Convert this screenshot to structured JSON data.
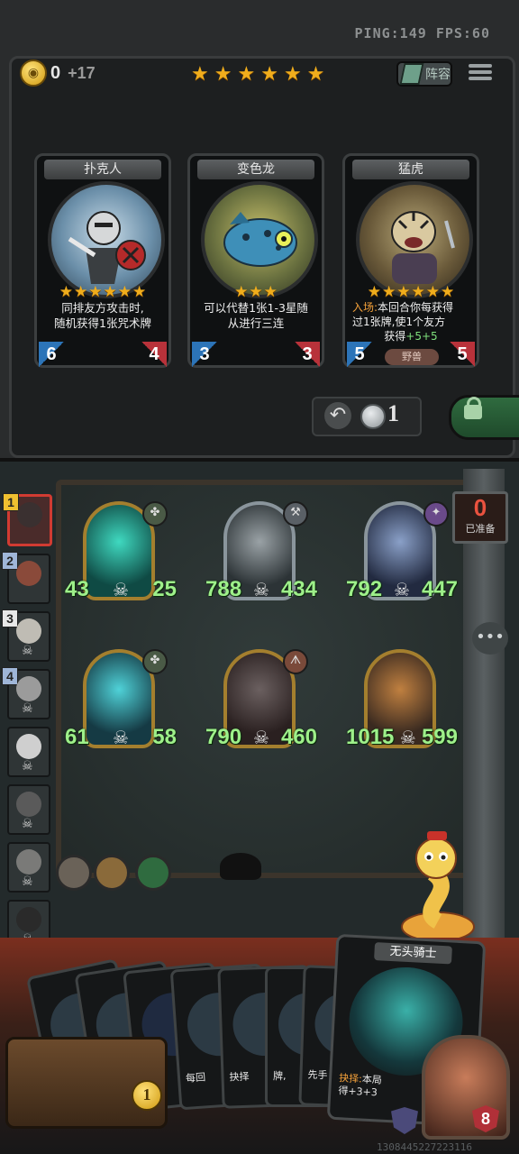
{
  "hud": {
    "ping": "PING:149",
    "fps": "FPS:60",
    "coins": "0",
    "coin_income": "+17",
    "tavern_stars": 6,
    "lineup_label": "阵容"
  },
  "shop": {
    "cards": [
      {
        "name": "扑克人",
        "stars": 6,
        "desc_1": "同排友方攻击时,",
        "desc_2": "随机获得1张咒术牌",
        "attack": "6",
        "health": "4"
      },
      {
        "name": "变色龙",
        "stars": 3,
        "desc_1": "可以代替1张1-3星随",
        "desc_2": "从进行三连",
        "attack": "3",
        "health": "3"
      },
      {
        "name": "猛虎",
        "stars": 6,
        "desc_hl": "入场:",
        "desc_1": "本回合你每获得",
        "desc_2": "过1张牌,使1个友方",
        "desc_3a": "获得",
        "desc_3b": "+5",
        "desc_3c": "+5",
        "tribe": "野兽",
        "attack": "5",
        "health": "5"
      }
    ],
    "refresh_cost": "1"
  },
  "board": {
    "ready_count": "0",
    "ready_label": "已准备",
    "minions": [
      {
        "attack": "43",
        "health": "25",
        "frame": "gold",
        "tribe_icon": "paw-icon"
      },
      {
        "attack": "788",
        "health": "434",
        "frame": "silver",
        "tribe_icon": "wrench-icon"
      },
      {
        "attack": "792",
        "health": "447",
        "frame": "silver",
        "tribe_icon": "magic-icon"
      },
      {
        "attack": "61",
        "health": "58",
        "frame": "gold",
        "tribe_icon": "paw-icon"
      },
      {
        "attack": "790",
        "health": "460",
        "frame": "gold",
        "tribe_icon": "claw-icon"
      },
      {
        "attack": "1015",
        "health": "599",
        "frame": "gold",
        "tribe_icon": "none"
      }
    ]
  },
  "players": {
    "ranks": [
      "1",
      "2",
      "3",
      "4"
    ]
  },
  "hand": {
    "big_card_name": "无头骑士",
    "big_card_hl": "抉择:",
    "big_card_text_1": "本局",
    "big_card_text_2": "得+3+3",
    "card_snippets": [
      "每回",
      "抉",
      "抉择",
      "牌,",
      "先手"
    ]
  },
  "hero": {
    "health": "8",
    "gold": "1"
  },
  "footer": {
    "build_id": "1308445227223116"
  },
  "colors": {
    "star": "#f0ad1c",
    "stat_green": "#9ef08a",
    "ready_red": "#e9523f"
  }
}
